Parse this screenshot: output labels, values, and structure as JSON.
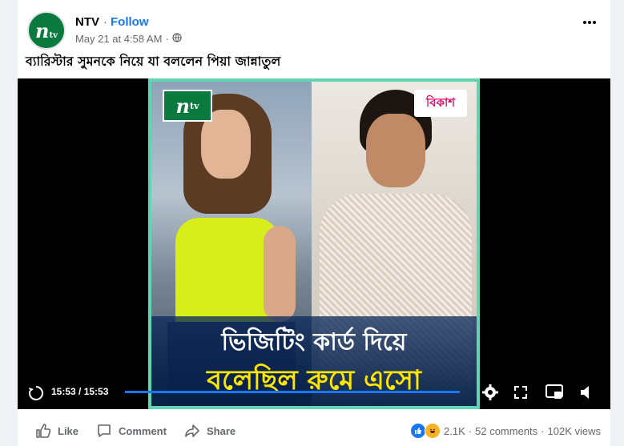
{
  "post": {
    "page_name": "NTV",
    "separator": "·",
    "follow_label": "Follow",
    "timestamp": "May 21 at 4:58 AM",
    "meta_dot": "·",
    "text": "ব্যারিস্টার সুমনকে নিয়ে যা বললেন পিয়া জান্নাতুল",
    "avatar_logo": "n",
    "avatar_logo_sub": "tv"
  },
  "video": {
    "thumb_logo_main": "n",
    "thumb_logo_sub": "tv",
    "sponsor_logo": "বিকাশ",
    "caption_line1": "ভিজিটিং কার্ড দিয়ে",
    "caption_line2": "বলেছিল রুমে এসো",
    "time_display": "15:53 / 15:53",
    "progress_fraction": 1.0,
    "accent_color": "#1877f2"
  },
  "actions": {
    "like": "Like",
    "comment": "Comment",
    "share": "Share"
  },
  "stats": {
    "reactions_count": "2.1K",
    "dot1": "·",
    "comments": "52 comments",
    "dot2": "·",
    "views": "102K views"
  }
}
